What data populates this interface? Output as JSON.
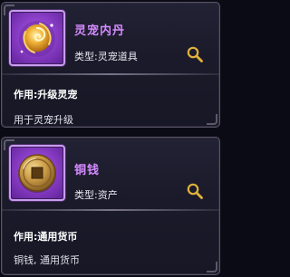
{
  "items": [
    {
      "name": "灵宠内丹",
      "type": "类型:灵宠道具",
      "usage": "作用:升级灵宠",
      "description": "用于灵宠升级",
      "icon": "spirit-pet-core-icon",
      "name_color": "#d58bff"
    },
    {
      "name": "铜钱",
      "type": "类型:资产",
      "usage": "作用:通用货币",
      "description": "铜钱, 通用货币",
      "icon": "copper-coin-icon",
      "name_color": "#d58bff"
    }
  ],
  "colors": {
    "frame_border": "#c99cf0",
    "frame_fill": "#8c3fc9",
    "magnifier": "#e0b23a"
  }
}
